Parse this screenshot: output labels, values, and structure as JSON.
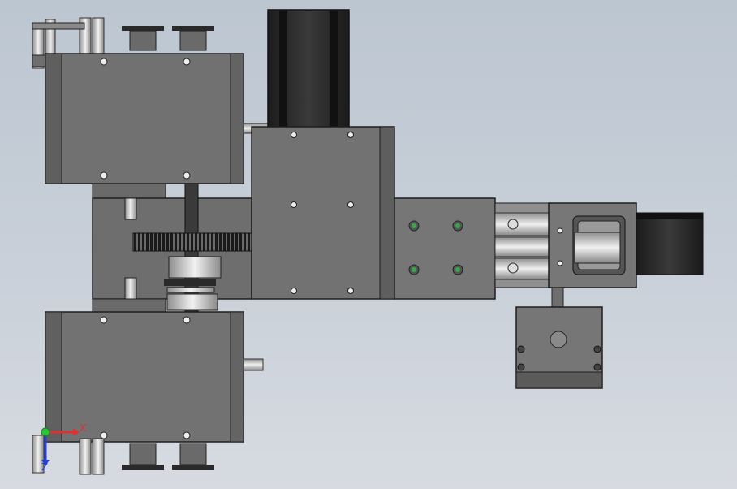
{
  "viewport": {
    "background_top": "#bcc6d1",
    "background_bottom": "#d7dbe1"
  },
  "model_colors": {
    "body": "#707070",
    "body_dark": "#4a4a4a",
    "edge": "#1e1e1e",
    "motor": "#262626",
    "steel": "#cfcfcf",
    "screw_green": "#35a84a"
  },
  "triad": {
    "x_label": "X",
    "z_label": "Z",
    "x_color": "#e03030",
    "y_color": "#2ec43a",
    "z_color": "#2b3fd6"
  }
}
